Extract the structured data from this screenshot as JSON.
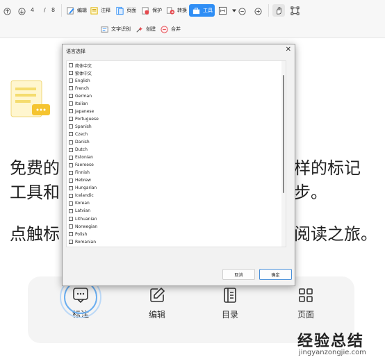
{
  "toolbar": {
    "page_current": "4",
    "page_sep": "/",
    "page_total": "8",
    "tools": [
      "编辑",
      "注释",
      "页面",
      "保护",
      "转换",
      "工具"
    ],
    "sub_tools": [
      "文字识别",
      "创建",
      "合并"
    ]
  },
  "document": {
    "line1_left": "免费的",
    "line1_right": "样的标记",
    "line2_left": "工具和",
    "line2_right": "步。",
    "line3_left": "点触标",
    "line3_right": "阅读之旅。"
  },
  "bottom_bar": {
    "items": [
      "标注",
      "编辑",
      "目录",
      "页面"
    ]
  },
  "dialog": {
    "title": "语言选择",
    "close": "✕",
    "languages": [
      "简体中文",
      "繁体中文",
      "English",
      "French",
      "German",
      "Italian",
      "Japanese",
      "Portuguese",
      "Spanish",
      "Czech",
      "Danish",
      "Dutch",
      "Estonian",
      "Faeroese",
      "Finnish",
      "Hebrew",
      "Hungarian",
      "Icelandic",
      "Korean",
      "Latvian",
      "Lithuanian",
      "Norwegian",
      "Polish",
      "Romanian"
    ],
    "cancel_label": "取消",
    "ok_label": "确定"
  },
  "watermark": {
    "cn": "经验总结",
    "en": "jingyanzongjie.com"
  },
  "colors": {
    "accent": "#2f8ef5",
    "watermark_accent": "#c0392b"
  }
}
